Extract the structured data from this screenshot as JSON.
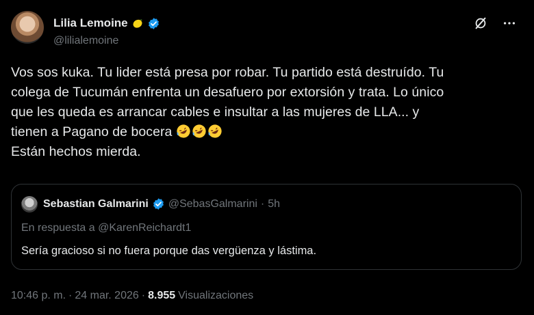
{
  "author": {
    "name": "Lilia Lemoine",
    "handle": "@lilialemoine",
    "name_emoji": "lemon-emoji",
    "verified_icon": "verified-badge-icon",
    "verified_color": "#1d9bf0"
  },
  "toolbar": {
    "grok_icon": "grok-icon",
    "more_icon": "more-options-icon"
  },
  "tweet": {
    "line1": "Vos sos kuka. Tu lider está presa por robar. Tu partido está destruído. Tu",
    "line2": "colega de Tucumán enfrenta un desafuero por extorsión y trata. Lo único",
    "line3": "que les queda es arrancar cables e insultar a las mujeres de LLA... y",
    "line4": "tienen a Pagano de bocera",
    "line4_emoji": "rolling-on-the-floor-laughing-emoji",
    "line5": "Están hechos mierda."
  },
  "quote": {
    "name": "Sebastian Galmarini",
    "handle": "@SebasGalmarini",
    "separator": "·",
    "time": "5h",
    "reply_prefix": "En respuesta a ",
    "reply_handle": "@KarenReichardt1",
    "text": "Sería gracioso si no fuera porque das vergüenza y lástima."
  },
  "footer": {
    "time": "10:46 p. m.",
    "sep1": "·",
    "date": "24 mar. 2026",
    "sep2": "·",
    "views_count": "8.955",
    "views_label": "Visualizaciones"
  },
  "colors": {
    "background": "#000000",
    "text": "#e7e9ea",
    "muted": "#71767b",
    "border": "#2f3336",
    "accent": "#1d9bf0"
  }
}
